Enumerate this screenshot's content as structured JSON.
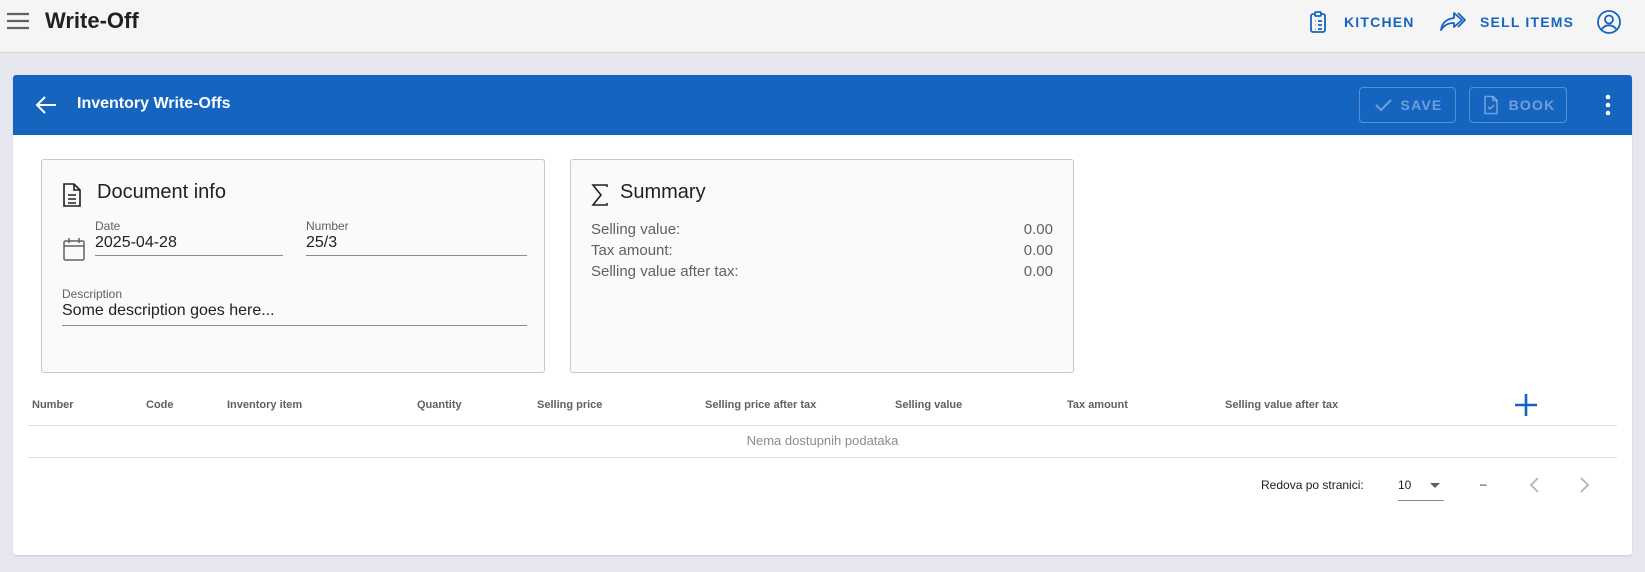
{
  "app": {
    "title": "Write-Off",
    "actions": [
      {
        "label": "KITCHEN",
        "icon": "clipboard-list-icon"
      },
      {
        "label": "SELL ITEMS",
        "icon": "share-arrow-icon"
      }
    ],
    "account_icon": "account-circle-icon"
  },
  "card": {
    "title": "Inventory Write-Offs",
    "save_label": "SAVE",
    "book_label": "BOOK",
    "accent": "#1565c0"
  },
  "document_info": {
    "title": "Document info",
    "date_label": "Date",
    "date_value": "2025-04-28",
    "number_label": "Number",
    "number_value": "25/3",
    "description_label": "Description",
    "description_value": "Some description goes here..."
  },
  "summary": {
    "title": "Summary",
    "rows": [
      {
        "label": "Selling value:",
        "value": "0.00"
      },
      {
        "label": "Tax amount:",
        "value": "0.00"
      },
      {
        "label": "Selling value after tax:",
        "value": "0.00"
      }
    ]
  },
  "table": {
    "columns": [
      "Number",
      "Code",
      "Inventory item",
      "Quantity",
      "Selling price",
      "Selling price after tax",
      "Selling value",
      "Tax amount",
      "Selling value after tax"
    ],
    "empty_text": "Nema dostupnih podataka"
  },
  "pagination": {
    "rows_per_page_label": "Redova po stranici:",
    "rows_per_page": "10",
    "range": "–"
  }
}
